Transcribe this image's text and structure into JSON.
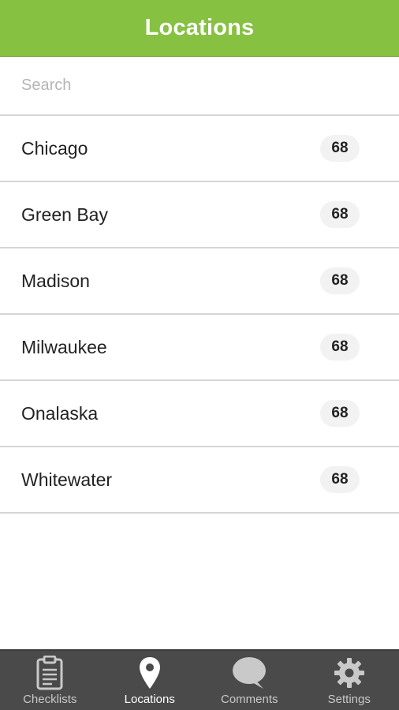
{
  "header": {
    "title": "Locations"
  },
  "search": {
    "placeholder": "Search",
    "value": ""
  },
  "locations": [
    {
      "name": "Chicago",
      "count": "68"
    },
    {
      "name": "Green Bay",
      "count": "68"
    },
    {
      "name": "Madison",
      "count": "68"
    },
    {
      "name": "Milwaukee",
      "count": "68"
    },
    {
      "name": "Onalaska",
      "count": "68"
    },
    {
      "name": "Whitewater",
      "count": "68"
    }
  ],
  "tabbar": {
    "tabs": [
      {
        "label": "Checklists",
        "icon": "clipboard-icon",
        "active": false
      },
      {
        "label": "Locations",
        "icon": "map-pin-icon",
        "active": true
      },
      {
        "label": "Comments",
        "icon": "speech-bubble-icon",
        "active": false
      },
      {
        "label": "Settings",
        "icon": "gear-icon",
        "active": false
      }
    ]
  },
  "colors": {
    "header_bg": "#86c142",
    "tabbar_bg": "#4a4a4a",
    "tab_icon_inactive": "#c9c9c9",
    "tab_icon_active": "#ffffff"
  }
}
